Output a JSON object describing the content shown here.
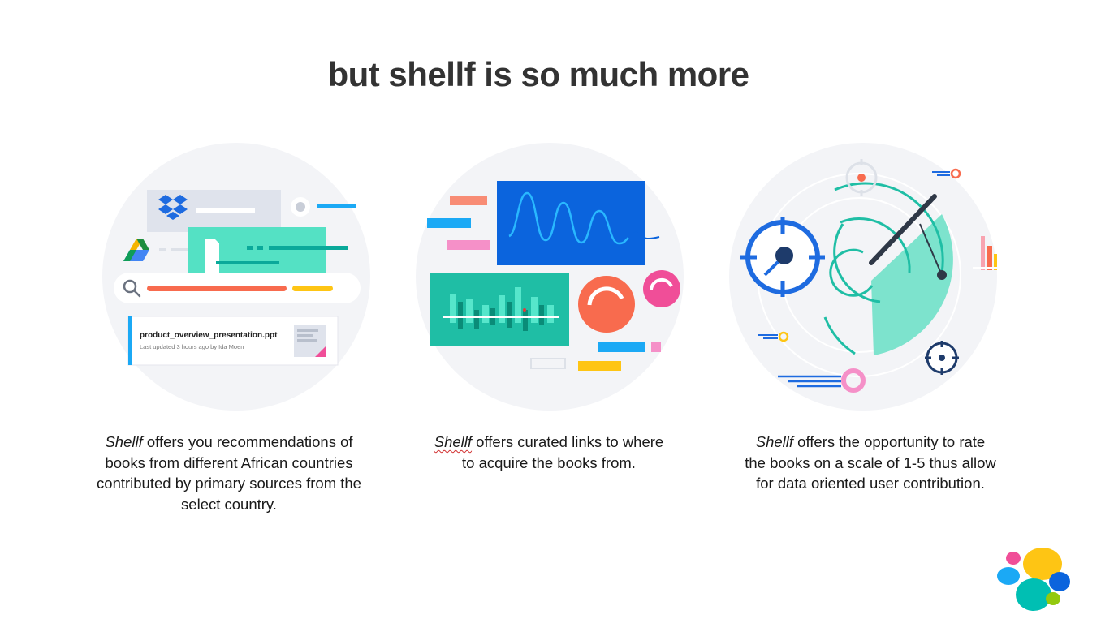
{
  "slide": {
    "title": "but shellf is so much more"
  },
  "panels": [
    {
      "brand": "Shellf",
      "text": " offers you recommendations of books from different African countries contributed by primary sources from the select country.",
      "illustration": {
        "file_name": "product_overview_presentation.ppt",
        "file_meta": "Last updated 3 hours ago by Ida Moen"
      }
    },
    {
      "brand": "Shellf",
      "text": " offers curated links to where to acquire the books from."
    },
    {
      "brand": "Shellf",
      "text": " offers the opportunity to rate the books on a scale of 1-5 thus allow for data oriented user contribution."
    }
  ],
  "colors": {
    "circle_bg": "#f3f4f7",
    "teal": "#54e1c4",
    "blue": "#0b64dd",
    "coral": "#f86b4e",
    "pink": "#f04e98",
    "yellow": "#fec514",
    "sky": "#1ba9f5"
  },
  "logo": {
    "icon": "colorful-blob-logo-icon"
  }
}
